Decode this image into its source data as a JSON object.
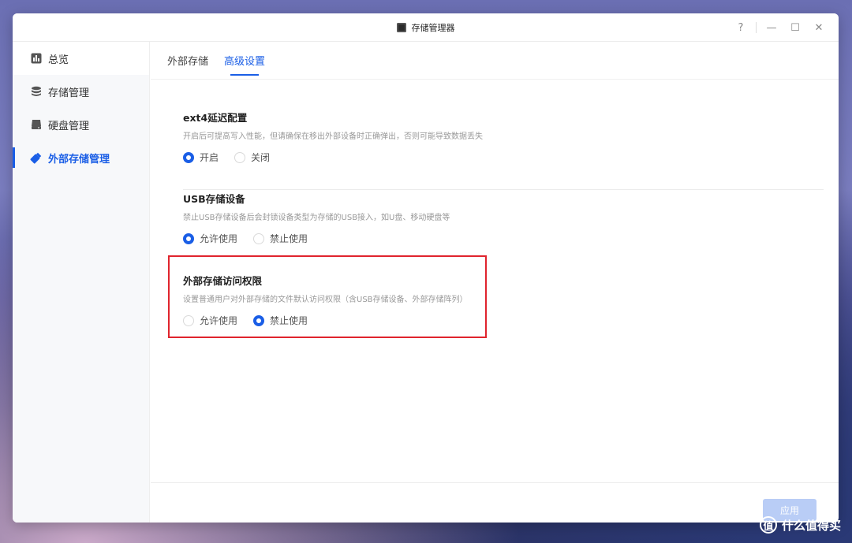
{
  "window": {
    "title": "存储管理器",
    "controls": {
      "help": "?",
      "minimize": "—",
      "maximize": "☐",
      "close": "✕"
    }
  },
  "sidebar": {
    "items": [
      {
        "label": "总览",
        "icon": "chart-icon"
      },
      {
        "label": "存储管理",
        "icon": "database-icon"
      },
      {
        "label": "硬盘管理",
        "icon": "disk-icon"
      },
      {
        "label": "外部存储管理",
        "icon": "usb-drive-icon",
        "active": true
      }
    ]
  },
  "tabs": [
    {
      "label": "外部存储",
      "active": false
    },
    {
      "label": "高级设置",
      "active": true
    }
  ],
  "sections": [
    {
      "title": "ext4延迟配置",
      "desc": "开启后可提高写入性能，但请确保在移出外部设备时正确弹出，否则可能导致数据丢失",
      "options": [
        "开启",
        "关闭"
      ],
      "selected": 0
    },
    {
      "title": "USB存储设备",
      "desc": "禁止USB存储设备后会封锁设备类型为存储的USB接入，如U盘、移动硬盘等",
      "options": [
        "允许使用",
        "禁止使用"
      ],
      "selected": 0
    },
    {
      "title": "外部存储访问权限",
      "desc": "设置普通用户对外部存储的文件默认访问权限（含USB存储设备、外部存储阵列）",
      "options": [
        "允许使用",
        "禁止使用"
      ],
      "selected": 1
    }
  ],
  "footer": {
    "apply_label": "应用"
  },
  "watermark": {
    "text": "什么值得买",
    "logo": "值"
  },
  "colors": {
    "accent": "#1a5ee6",
    "highlight": "#e0242d",
    "apply_disabled": "#b9cdf6"
  }
}
